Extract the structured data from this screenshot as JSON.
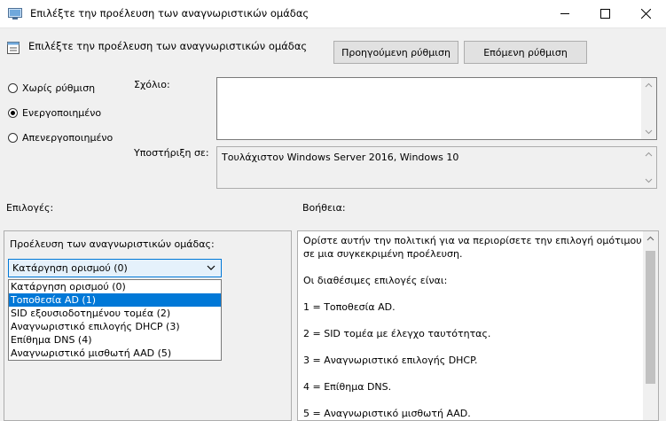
{
  "window": {
    "title": "Επιλέξτε την προέλευση των αναγνωριστικών ομάδας",
    "minimize_icon": "minimize-icon",
    "maximize_icon": "maximize-icon",
    "close_icon": "close-icon"
  },
  "header": {
    "title": "Επιλέξτε την προέλευση των αναγνωριστικών ομάδας",
    "prev_button": "Προηγούμενη ρύθμιση",
    "next_button": "Επόμενη ρύθμιση"
  },
  "state": {
    "options": [
      {
        "label": "Χωρίς ρύθμιση",
        "checked": false
      },
      {
        "label": "Ενεργοποιημένο",
        "checked": true
      },
      {
        "label": "Απενεργοποιημένο",
        "checked": false
      }
    ]
  },
  "comment": {
    "label": "Σχόλιο:",
    "value": ""
  },
  "support": {
    "label": "Υποστήριξη σε:",
    "value": "Τουλάχιστον Windows Server 2016, Windows 10"
  },
  "options_panel": {
    "label": "Επιλογές:",
    "field_label": "Προέλευση των αναγνωριστικών ομάδας:",
    "selected": "Κατάργηση ορισμού (0)",
    "items": [
      "Κατάργηση ορισμού (0)",
      "Τοποθεσία AD (1)",
      "SID εξουσιοδοτημένου τομέα (2)",
      "Αναγνωριστικό επιλογής DHCP (3)",
      "Επίθημα DNS (4)",
      "Αναγνωριστικό μισθωτή AAD (5)"
    ],
    "highlighted_index": 1
  },
  "help_panel": {
    "label": "Βοήθεια:",
    "lines": [
      "Ορίστε αυτήν την πολιτική για να περιορίσετε την επιλογή ομότιμου",
      "σε μια συγκεκριμένη προέλευση.",
      "Οι διαθέσιμες επιλογές είναι:",
      "1 = Τοποθεσία AD.",
      "2 = SID τομέα με έλεγχο ταυτότητας.",
      "3 = Αναγνωριστικό επιλογής DHCP.",
      "4 = Επίθημα DNS.",
      "5 = Αναγνωριστικό μισθωτή AAD."
    ]
  },
  "colors": {
    "accent": "#0078d7",
    "dialog_bg": "#f0f0f0"
  }
}
